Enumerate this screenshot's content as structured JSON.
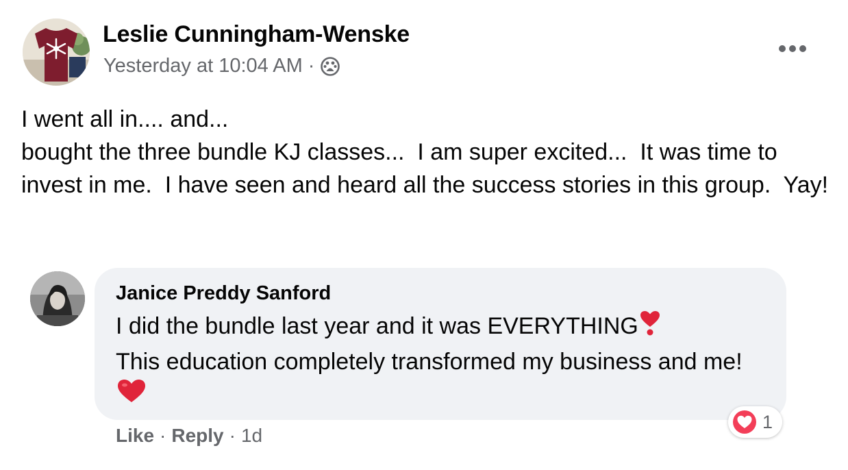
{
  "post": {
    "author": "Leslie Cunningham-Wenske",
    "timestamp": "Yesterday at 10:04 AM",
    "separator": "·",
    "audience_icon": "group-icon",
    "more_icon": "more-horizontal-icon",
    "text": "I went all in.... and...\nbought the three bundle KJ classes...  I am super excited...  It was time to invest in me.  I have seen and heard all the success stories in this group.  Yay!"
  },
  "comment": {
    "author": "Janice Preddy Sanford",
    "text_line1": "I did the bundle last year and it was EVERYTHING",
    "text_line2": "This education completely transformed my business and me! ",
    "emoji_1": "heart-exclamation-emoji",
    "emoji_2": "red-heart-emoji",
    "reaction_icon": "love-reaction-icon",
    "reaction_count": "1",
    "actions": {
      "like": "Like",
      "reply": "Reply",
      "age": "1d",
      "separator": "·"
    }
  },
  "colors": {
    "secondary_text": "#65676b",
    "bubble_bg": "#f0f2f5",
    "love_red": "#f33e58"
  }
}
